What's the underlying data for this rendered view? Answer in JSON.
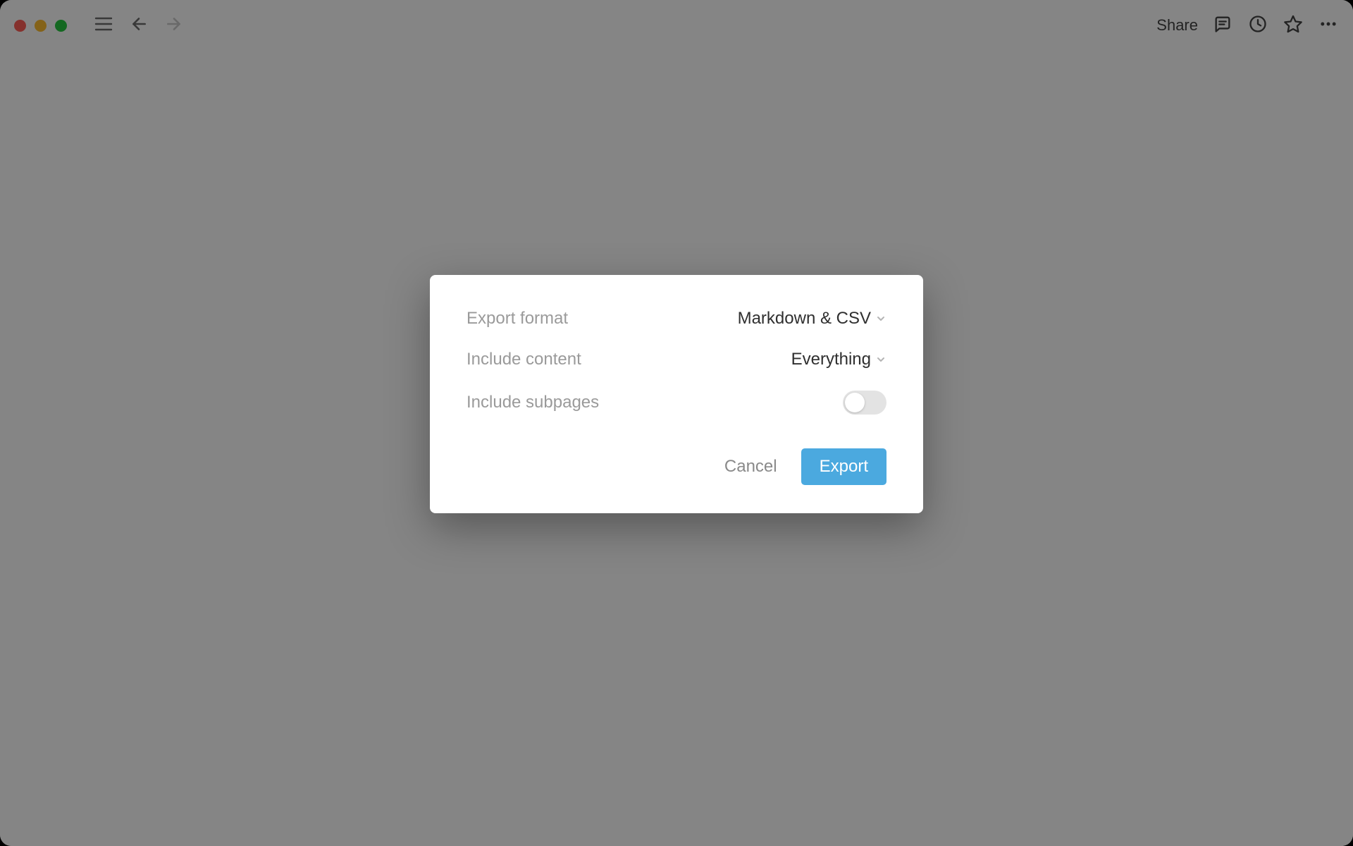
{
  "toolbar": {
    "share_label": "Share"
  },
  "modal": {
    "rows": {
      "format": {
        "label": "Export format",
        "value": "Markdown & CSV"
      },
      "content": {
        "label": "Include content",
        "value": "Everything"
      },
      "subpages": {
        "label": "Include subpages",
        "toggle_on": false
      }
    },
    "actions": {
      "cancel": "Cancel",
      "export": "Export"
    }
  },
  "colors": {
    "primary": "#4ba9df"
  }
}
